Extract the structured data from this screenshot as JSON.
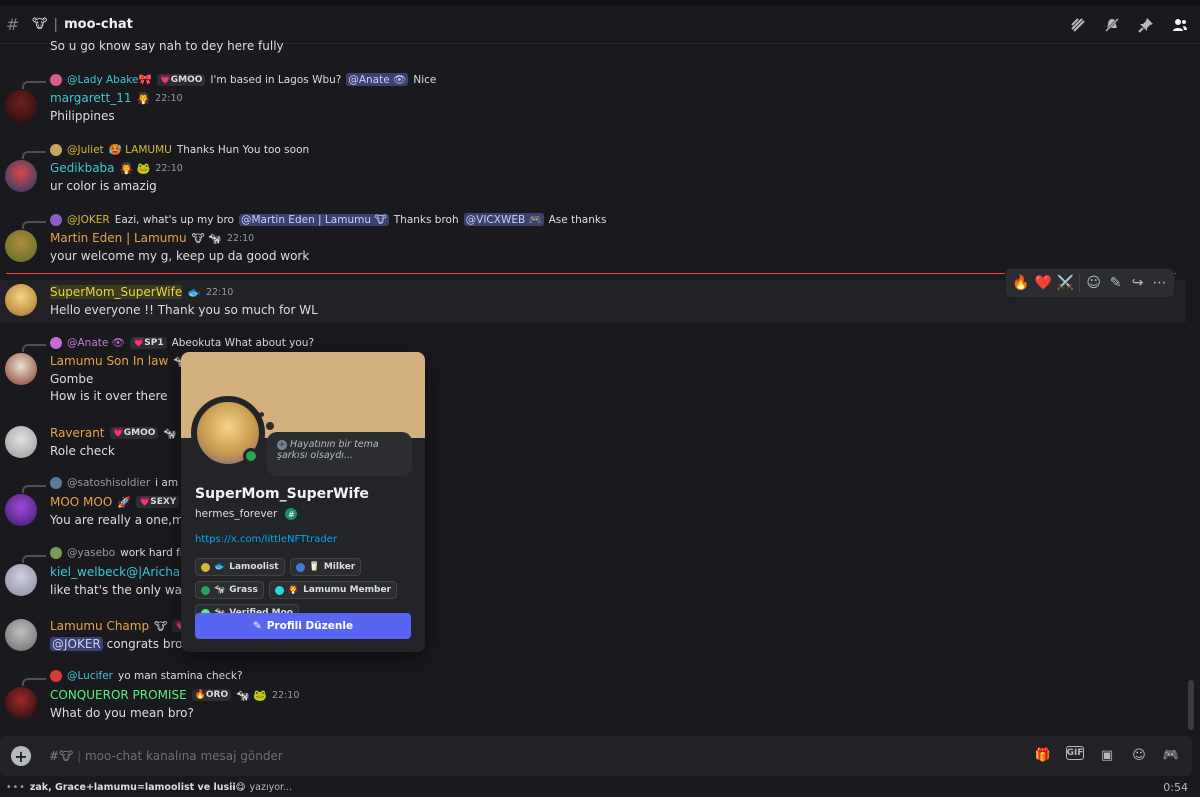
{
  "header": {
    "channel_name": "moo-chat",
    "icons": [
      "threads-icon",
      "mute-icon",
      "pin-icon",
      "members-icon"
    ]
  },
  "messages": [
    {
      "text": "So u go know say nah to dey here fully"
    },
    {
      "reply_name": "@Lady Abake🎀",
      "reply_badge": "💗GMOO",
      "reply_text": "I'm based in Lagos Wbu?",
      "reply_mention": "@Anate 👁",
      "reply_tail": "Nice",
      "name": "margarett_11",
      "name_color": "#3ec7d8",
      "emoji": "🧛",
      "time": "22:10",
      "text": "Philippines"
    },
    {
      "reply_name": "@Juliet",
      "reply_extra": "🥵 LAMUMU",
      "reply_text": "Thanks Hun You too soon",
      "name": "Gedikbaba",
      "name_color": "#3ec7d8",
      "emoji": "🧛 🐸",
      "time": "22:10",
      "text": "ur color is amazig"
    },
    {
      "reply_name": "@JOKER",
      "reply_text": "Eazi, what's up my bro",
      "reply_mention": "@Martin Eden | Lamumu 🐮",
      "reply_tail": "Thanks broh",
      "reply_mention2": "@VICXWEB 🎮",
      "reply_tail2": "Ase thanks",
      "name": "Martin Eden | Lamumu",
      "name_color": "#e8a34a",
      "emoji": "🐮 🐄",
      "time": "22:10",
      "text": "your welcome my g, keep up da good work"
    },
    {
      "name": "SuperMom_SuperWife",
      "name_color": "#e8d24a",
      "emoji": "🐟",
      "time": "22:10",
      "text": "Hello everyone !! Thank you so much for WL"
    },
    {
      "reply_name": "@Anate 👁",
      "reply_badge": "💗SP1",
      "reply_text": "Abeokuta  What about you?",
      "name": "Lamumu Son In law",
      "name_color": "#e8a34a",
      "emoji": "🐄",
      "text": "Gombe",
      "text2": "How is it over there"
    },
    {
      "name": "Raverant",
      "name_color": "#e8a34a",
      "badge": "💗GMOO",
      "emoji": "🐄 🐸",
      "text": "Role check"
    },
    {
      "reply_name": "@satoshisoldier",
      "reply_text": "i am co",
      "name": "MOO MOO",
      "name_color": "#e8a34a",
      "emoji": "🚀",
      "badge": "💗SEXY",
      "text": "You are really a one,moo"
    },
    {
      "reply_name": "@yasebo",
      "reply_text": "work hard frie",
      "name": "kiel_welbeck@|Arichain",
      "name_color": "#3ec7d8",
      "text": "like that's the only way f"
    },
    {
      "name": "Lamumu Champ",
      "name_color": "#e8a34a",
      "emoji": "🐮",
      "badge": "💗G",
      "mention": "@JOKER",
      "text": "congrats bro"
    },
    {
      "reply_name": "@Lucifer",
      "reply_text": "yo man stamina check?",
      "name": "CONQUEROR PROMISE",
      "name_color": "#5bf07a",
      "badge": "🔥ORO",
      "emoji": "🐄 🐸",
      "time": "22:10",
      "text": "What do you mean bro?"
    }
  ],
  "hover_tools": [
    "🔥",
    "❤️",
    "⚔️",
    "☺",
    "✎",
    "↪",
    "⋯"
  ],
  "popout": {
    "display_name": "SuperMom_SuperWife",
    "username": "hermes_forever",
    "status_bubble": "Hayatının bir tema şarkısı olsaydı...",
    "link": "https://x.com/littleNFTtrader",
    "roles": [
      {
        "label": "Lamoolist",
        "emoji": "🐟",
        "color": "#d4b83a"
      },
      {
        "label": "Milker",
        "emoji": "🥛",
        "color": "#3b7dd8"
      },
      {
        "label": "Grass",
        "emoji": "🐄",
        "color": "#23a55a"
      },
      {
        "label": "Lamumu Member",
        "emoji": "🧛",
        "color": "#2ed3e0"
      },
      {
        "label": "Verified Moo",
        "emoji": "🐄",
        "color": "#5bf07a"
      }
    ],
    "button": "Profili Düzenle"
  },
  "composer": {
    "placeholder": "moo-chat kanalına mesaj gönder",
    "prefix": "#🐮"
  },
  "typing": {
    "names": "zak, Grace+lamumu=lamoolist ve lusii",
    "emoji": "😋",
    "suffix": "yazıyor...",
    "clock": "0:54"
  }
}
